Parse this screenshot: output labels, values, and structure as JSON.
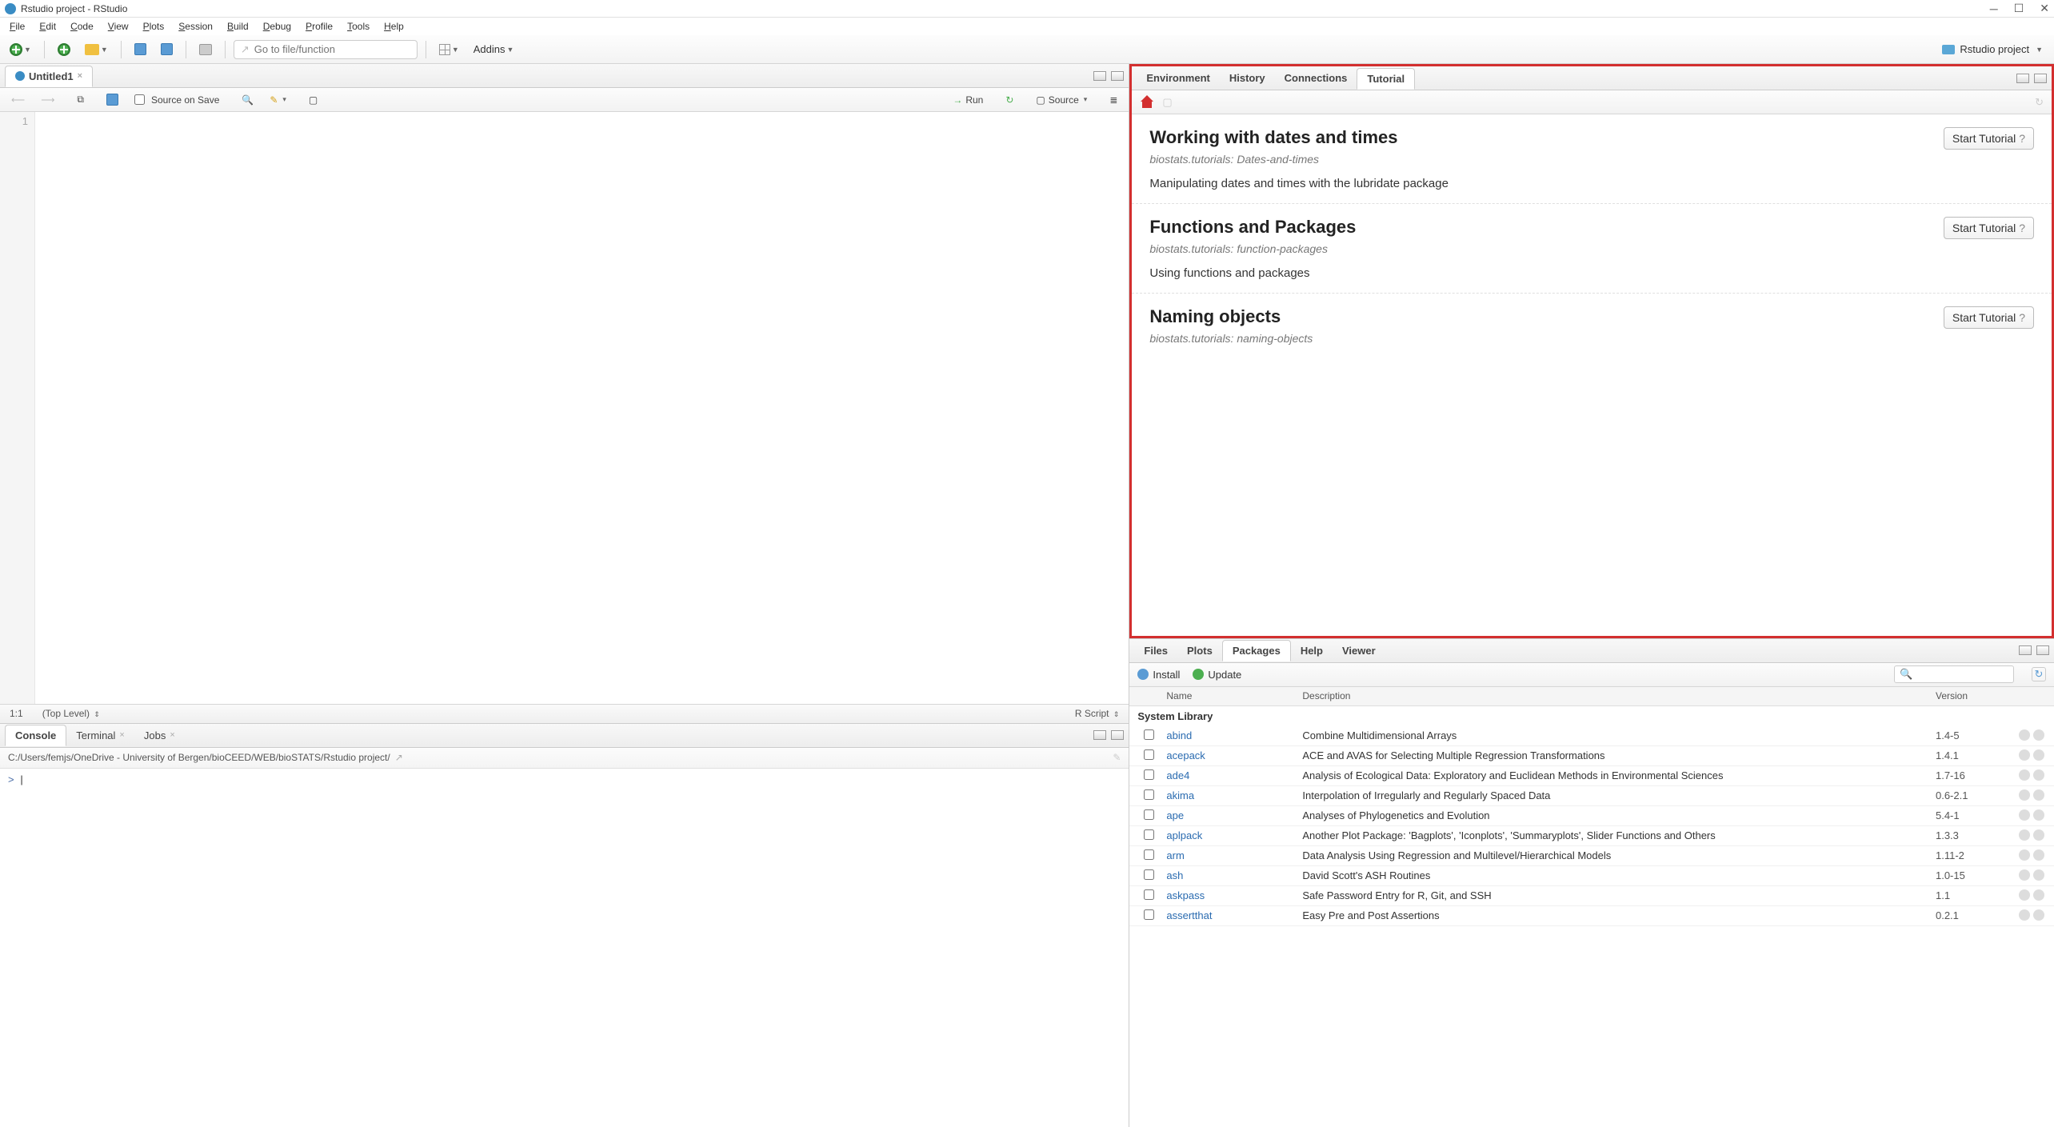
{
  "titlebar": {
    "title": "Rstudio project - RStudio"
  },
  "menubar": [
    "File",
    "Edit",
    "Code",
    "View",
    "Plots",
    "Session",
    "Build",
    "Debug",
    "Profile",
    "Tools",
    "Help"
  ],
  "toolbar": {
    "goto_placeholder": "Go to file/function",
    "addins": "Addins",
    "project": "Rstudio project"
  },
  "source": {
    "tab": "Untitled1",
    "save_on_save": "Source on Save",
    "run": "Run",
    "source_btn": "Source",
    "line_no": "1",
    "status_pos": "1:1",
    "status_scope": "(Top Level)",
    "status_type": "R Script"
  },
  "console": {
    "tabs": {
      "console": "Console",
      "terminal": "Terminal",
      "jobs": "Jobs"
    },
    "path": "C:/Users/femjs/OneDrive - University of Bergen/bioCEED/WEB/bioSTATS/Rstudio project/",
    "prompt": ">"
  },
  "tutorial_pane": {
    "tabs": {
      "env": "Environment",
      "hist": "History",
      "conn": "Connections",
      "tut": "Tutorial"
    },
    "items": [
      {
        "title": "Working with dates and times",
        "subtitle": "biostats.tutorials: Dates-and-times",
        "desc": "Manipulating dates and times with the lubridate package"
      },
      {
        "title": "Functions and Packages",
        "subtitle": "biostats.tutorials: function-packages",
        "desc": "Using functions and packages"
      },
      {
        "title": "Naming objects",
        "subtitle": "biostats.tutorials: naming-objects",
        "desc": ""
      }
    ],
    "start_label": "Start Tutorial"
  },
  "packages_pane": {
    "tabs": {
      "files": "Files",
      "plots": "Plots",
      "packages": "Packages",
      "help": "Help",
      "viewer": "Viewer"
    },
    "install": "Install",
    "update": "Update",
    "headers": {
      "name": "Name",
      "desc": "Description",
      "ver": "Version"
    },
    "section": "System Library",
    "rows": [
      {
        "name": "abind",
        "desc": "Combine Multidimensional Arrays",
        "ver": "1.4-5"
      },
      {
        "name": "acepack",
        "desc": "ACE and AVAS for Selecting Multiple Regression Transformations",
        "ver": "1.4.1"
      },
      {
        "name": "ade4",
        "desc": "Analysis of Ecological Data: Exploratory and Euclidean Methods in Environmental Sciences",
        "ver": "1.7-16"
      },
      {
        "name": "akima",
        "desc": "Interpolation of Irregularly and Regularly Spaced Data",
        "ver": "0.6-2.1"
      },
      {
        "name": "ape",
        "desc": "Analyses of Phylogenetics and Evolution",
        "ver": "5.4-1"
      },
      {
        "name": "aplpack",
        "desc": "Another Plot Package: 'Bagplots', 'Iconplots', 'Summaryplots', Slider Functions and Others",
        "ver": "1.3.3"
      },
      {
        "name": "arm",
        "desc": "Data Analysis Using Regression and Multilevel/Hierarchical Models",
        "ver": "1.11-2"
      },
      {
        "name": "ash",
        "desc": "David Scott's ASH Routines",
        "ver": "1.0-15"
      },
      {
        "name": "askpass",
        "desc": "Safe Password Entry for R, Git, and SSH",
        "ver": "1.1"
      },
      {
        "name": "assertthat",
        "desc": "Easy Pre and Post Assertions",
        "ver": "0.2.1"
      }
    ]
  }
}
